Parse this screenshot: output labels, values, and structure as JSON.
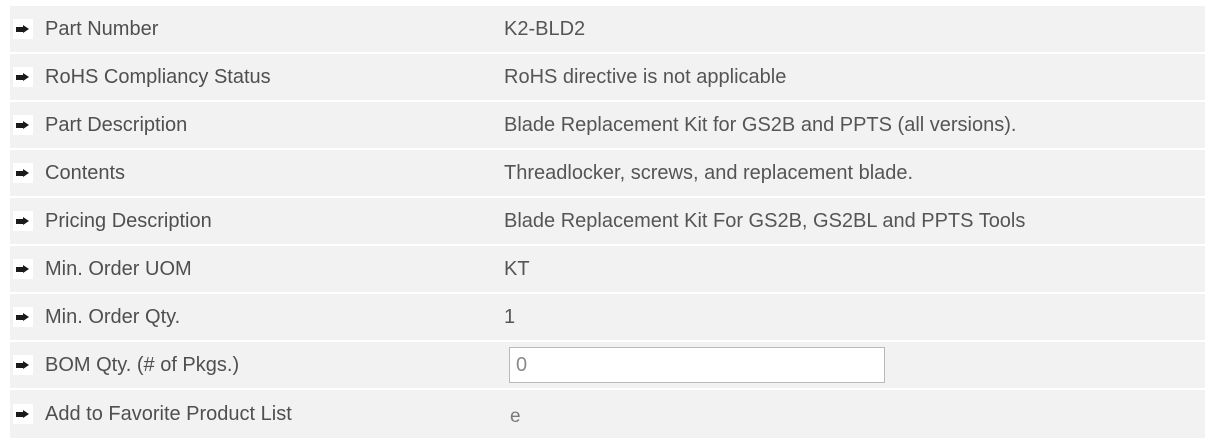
{
  "rows": [
    {
      "label": "Part Number",
      "value": "K2-BLD2"
    },
    {
      "label": "RoHS Compliancy Status",
      "value": "RoHS directive is not applicable"
    },
    {
      "label": "Part Description",
      "value": "Blade Replacement Kit for GS2B and PPTS (all versions)."
    },
    {
      "label": "Contents",
      "value": "Threadlocker, screws, and replacement blade."
    },
    {
      "label": "Pricing Description",
      "value": "Blade Replacement Kit For GS2B, GS2BL and PPTS Tools"
    },
    {
      "label": "Min. Order UOM",
      "value": "KT"
    },
    {
      "label": "Min. Order Qty.",
      "value": "1"
    },
    {
      "label": "BOM Qty. (# of Pkgs.)",
      "input_value": "0"
    },
    {
      "label": "Add to Favorite Product List",
      "toggle_glyph": "e"
    }
  ],
  "icons": {
    "bullet": "arrow-bullet-icon"
  },
  "colors": {
    "stripe": "#f2f2f2",
    "text": "#4f4f4f",
    "input_border": "#b9b9b9"
  }
}
